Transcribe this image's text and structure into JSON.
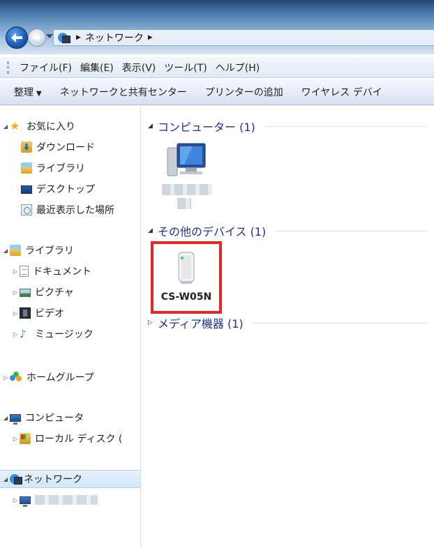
{
  "address": {
    "crumbs": [
      "ネットワーク"
    ]
  },
  "menu": {
    "items": [
      "ファイル(F)",
      "編集(E)",
      "表示(V)",
      "ツール(T)",
      "ヘルプ(H)"
    ]
  },
  "commands": {
    "items": [
      "整理",
      "ネットワークと共有センター",
      "プリンターの追加",
      "ワイヤレス デバイ"
    ]
  },
  "nav": {
    "favorites": "お気に入り",
    "downloads": "ダウンロード",
    "libraries_fav": "ライブラリ",
    "desktop": "デスクトップ",
    "recent": "最近表示した場所",
    "libraries": "ライブラリ",
    "documents": "ドキュメント",
    "pictures": "ピクチャ",
    "videos": "ビデオ",
    "music": "ミュージック",
    "homegroup": "ホームグループ",
    "computer": "コンピュータ",
    "local_disk": "ローカル ディスク (",
    "network": "ネットワーク"
  },
  "content": {
    "sections": [
      {
        "title": "コンピューター (1)"
      },
      {
        "title": "その他のデバイス (1)"
      },
      {
        "title": "メディア機器 (1)"
      }
    ],
    "device_name": "CS-W05N"
  },
  "colors": {
    "section_title": "#1e3287",
    "highlight": "#e42727",
    "selected_nav": "#d1e5fa"
  }
}
